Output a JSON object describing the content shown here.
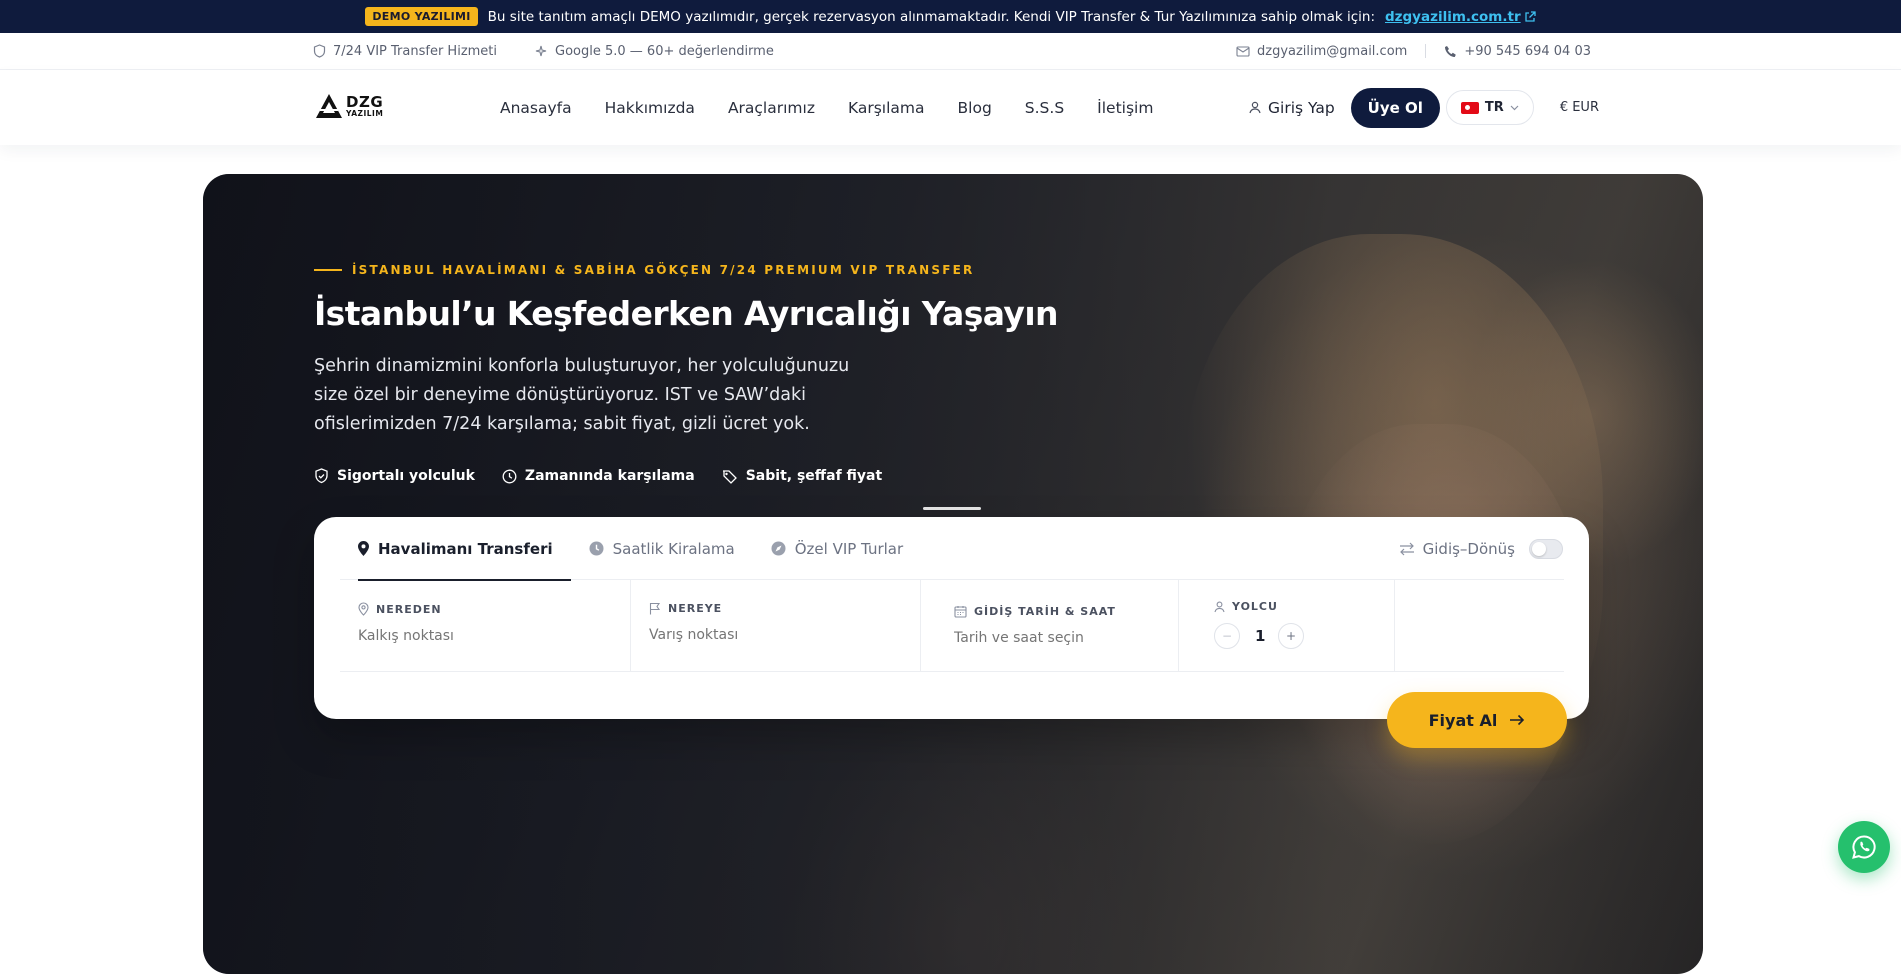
{
  "demo_banner": {
    "badge": "DEMO YAZILIMI",
    "message": "Bu site tanıtım amaçlı DEMO yazılımıdır, gerçek rezervasyon alınmamaktadır. Kendi VIP Transfer & Tur Yazılımınıza sahip olmak için:",
    "link": "dzgyazilim.com.tr"
  },
  "info_bar": {
    "service": "7/24 VIP Transfer Hizmeti",
    "rating": "Google 5.0 — 60+ değerlendirme",
    "email": "dzgyazilim@gmail.com",
    "phone": "+90 545 694 04 03"
  },
  "nav": {
    "logo_main": "DZG",
    "logo_sub": "YAZILIM",
    "menu": [
      "Anasayfa",
      "Hakkımızda",
      "Araçlarımız",
      "Karşılama",
      "Blog",
      "S.S.S",
      "İletişim"
    ],
    "login": "Giriş Yap",
    "signup": "Üye Ol",
    "language": "TR",
    "currency": "€ EUR"
  },
  "hero": {
    "eyebrow": "İSTANBUL HAVALİMANI & SABİHA GÖKÇEN 7/24 PREMIUM VIP TRANSFER",
    "title": "İstanbul’u Keşfederken Ayrıcalığı Yaşayın",
    "subtitle": "Şehrin dinamizmini konforla buluşturuyor, her yolculuğunuzu size özel bir deneyime dönüştürüyoruz. IST ve SAW’daki ofislerimizden 7/24 karşılama; sabit fiyat, gizli ücret yok.",
    "features": [
      "Sigortalı yolculuk",
      "Zamanında karşılama",
      "Sabit, şeffaf fiyat"
    ]
  },
  "booking": {
    "tabs": [
      "Havalimanı Transferi",
      "Saatlik Kiralama",
      "Özel VIP Turlar"
    ],
    "active_tab": "Havalimanı Transferi",
    "round_trip_label": "Gidiş–Dönüş",
    "round_trip_enabled": false,
    "from_label": "NEREDEN",
    "from_placeholder": "Kalkış noktası",
    "to_label": "NEREYE",
    "to_placeholder": "Varış noktası",
    "date_label": "GİDİŞ TARİH & SAAT",
    "date_placeholder": "Tarih ve saat seçin",
    "passenger_label": "YOLCU",
    "passenger_minus": "−",
    "passenger_count": "1",
    "passenger_plus": "+",
    "submit": "Fiyat Al"
  },
  "colors": {
    "navy": "#0f1b3d",
    "accent": "#f5b51c",
    "link": "#3ec0f0",
    "whatsapp": "#25c06d"
  }
}
